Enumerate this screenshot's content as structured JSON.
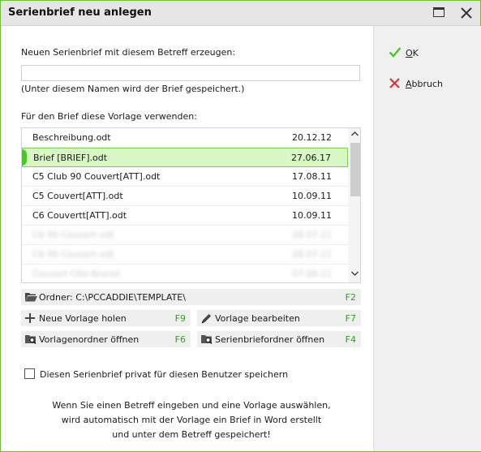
{
  "window": {
    "title": "Serienbrief neu anlegen"
  },
  "form": {
    "subject_label": "Neuen Serienbrief mit diesem Betreff erzeugen:",
    "subject_value": "",
    "subject_hint": "(Unter diesem Namen wird der Brief gespeichert.)",
    "template_label": "Für den Brief diese Vorlage verwenden:"
  },
  "templates": [
    {
      "name": "Beschreibung.odt",
      "date": "20.12.12"
    },
    {
      "name": "Brief [BRIEF].odt",
      "date": "27.06.17"
    },
    {
      "name": "C5 Club 90 Couvert[ATT].odt",
      "date": "17.08.11"
    },
    {
      "name": "C5 Couvert[ATT].odt",
      "date": "10.09.11"
    },
    {
      "name": "C6 Couvertt[ATT].odt",
      "date": "10.09.11"
    },
    {
      "name": "C6 90 Couvert.odt",
      "date": "28.07.11"
    },
    {
      "name": "C6 90 Couvert.odt",
      "date": "28.07.11"
    },
    {
      "name": "Couvert C6d Brunst",
      "date": "07.09.11"
    }
  ],
  "folder": {
    "label": "Ordner: C:\\PCCADDIE\\TEMPLATE\\",
    "key": "F2"
  },
  "buttons": {
    "new_template": {
      "label": "Neue Vorlage holen",
      "key": "F9"
    },
    "edit_template": {
      "label": "Vorlage bearbeiten",
      "key": "F7"
    },
    "open_template_folder": {
      "label": "Vorlagenordner öffnen",
      "key": "F6"
    },
    "open_letter_folder": {
      "label": "Serienbriefordner öffnen",
      "key": "F4"
    }
  },
  "private_checkbox": {
    "label": "Diesen Serienbrief privat für diesen Benutzer speichern",
    "checked": false
  },
  "info_lines": [
    "Wenn Sie einen Betreff eingeben und eine Vorlage auswählen,",
    "wird automatisch mit der Vorlage ein Brief in Word erstellt",
    "und unter dem Betreff gespeichert!"
  ],
  "actions": {
    "ok_label": "OK",
    "cancel_label": "Abbruch"
  },
  "colors": {
    "accent_green": "#3ccd1e",
    "selected_bg": "#d8f7c4",
    "cancel_red": "#e0302a"
  }
}
